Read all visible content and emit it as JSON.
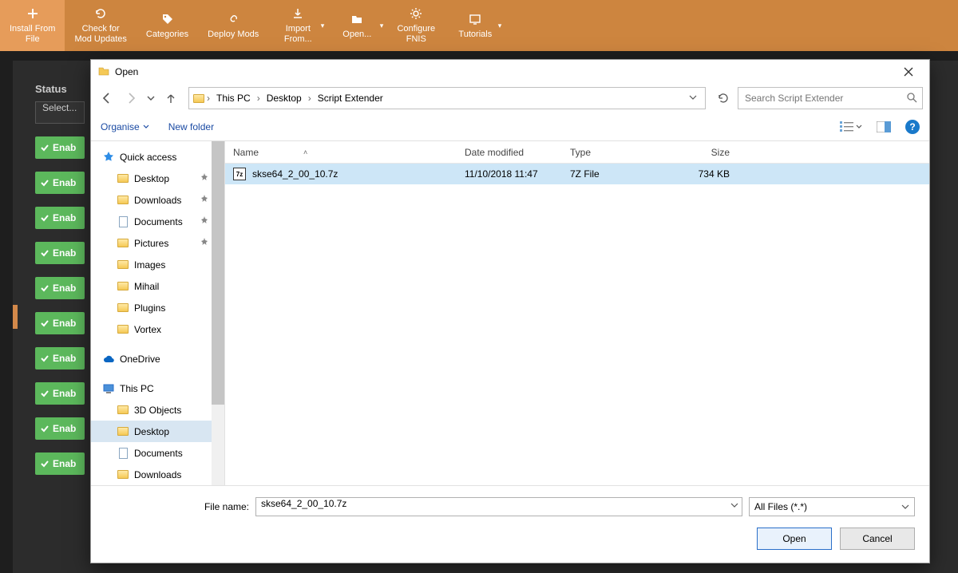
{
  "vortex": {
    "toolbar": [
      {
        "key": "install",
        "label": "Install From File",
        "icon": "plus",
        "selected": true
      },
      {
        "key": "check",
        "label": "Check for Mod Updates",
        "icon": "refresh"
      },
      {
        "key": "categories",
        "label": "Categories",
        "icon": "tag"
      },
      {
        "key": "deploy",
        "label": "Deploy Mods",
        "icon": "link"
      },
      {
        "key": "import",
        "label": "Import From...",
        "icon": "download",
        "dropdown": true
      },
      {
        "key": "open",
        "label": "Open...",
        "icon": "folder",
        "dropdown": true
      },
      {
        "key": "fnis",
        "label": "Configure FNIS",
        "icon": "gear"
      },
      {
        "key": "tutorials",
        "label": "Tutorials",
        "icon": "tv",
        "dropdown": true
      }
    ],
    "status_label": "Status",
    "select_placeholder": "Select...",
    "enable_label": "Enab",
    "enable_count": 10
  },
  "dialog": {
    "title": "Open",
    "nav": {
      "back": true,
      "forward": false,
      "recent": true,
      "up": true
    },
    "breadcrumbs": [
      "This PC",
      "Desktop",
      "Script Extender"
    ],
    "refresh_icon": "refresh",
    "search_placeholder": "Search Script Extender",
    "toolbar": {
      "organise": "Organise",
      "new_folder": "New folder",
      "view": "details",
      "preview": "preview",
      "help": "?"
    },
    "tree": [
      {
        "label": "Quick access",
        "icon": "star",
        "color": "#2e8de6"
      },
      {
        "label": "Desktop",
        "icon": "folder",
        "indent": 1,
        "pinned": true
      },
      {
        "label": "Downloads",
        "icon": "folder",
        "indent": 1,
        "pinned": true
      },
      {
        "label": "Documents",
        "icon": "doc",
        "indent": 1,
        "pinned": true
      },
      {
        "label": "Pictures",
        "icon": "folder",
        "indent": 1,
        "pinned": true
      },
      {
        "label": "Images",
        "icon": "folder",
        "indent": 1
      },
      {
        "label": "Mihail",
        "icon": "folder",
        "indent": 1
      },
      {
        "label": "Plugins",
        "icon": "folder",
        "indent": 1
      },
      {
        "label": "Vortex",
        "icon": "folder",
        "indent": 1
      },
      {
        "label": "OneDrive",
        "icon": "cloud",
        "color": "#0a66c2"
      },
      {
        "label": "This PC",
        "icon": "pc",
        "color": "#2e8de6"
      },
      {
        "label": "3D Objects",
        "icon": "folder",
        "indent": 1
      },
      {
        "label": "Desktop",
        "icon": "folder",
        "indent": 1,
        "selected": true
      },
      {
        "label": "Documents",
        "icon": "doc",
        "indent": 1
      },
      {
        "label": "Downloads",
        "icon": "folder",
        "indent": 1
      }
    ],
    "columns": {
      "name": "Name",
      "date": "Date modified",
      "type": "Type",
      "size": "Size"
    },
    "sort_column": "name",
    "files": [
      {
        "name": "skse64_2_00_10.7z",
        "date": "11/10/2018 11:47",
        "type": "7Z File",
        "size": "734 KB",
        "selected": true,
        "icon": "7z"
      }
    ],
    "filename_label": "File name:",
    "filename_value": "skse64_2_00_10.7z",
    "filter": "All Files (*.*)",
    "open_btn": "Open",
    "cancel_btn": "Cancel"
  }
}
